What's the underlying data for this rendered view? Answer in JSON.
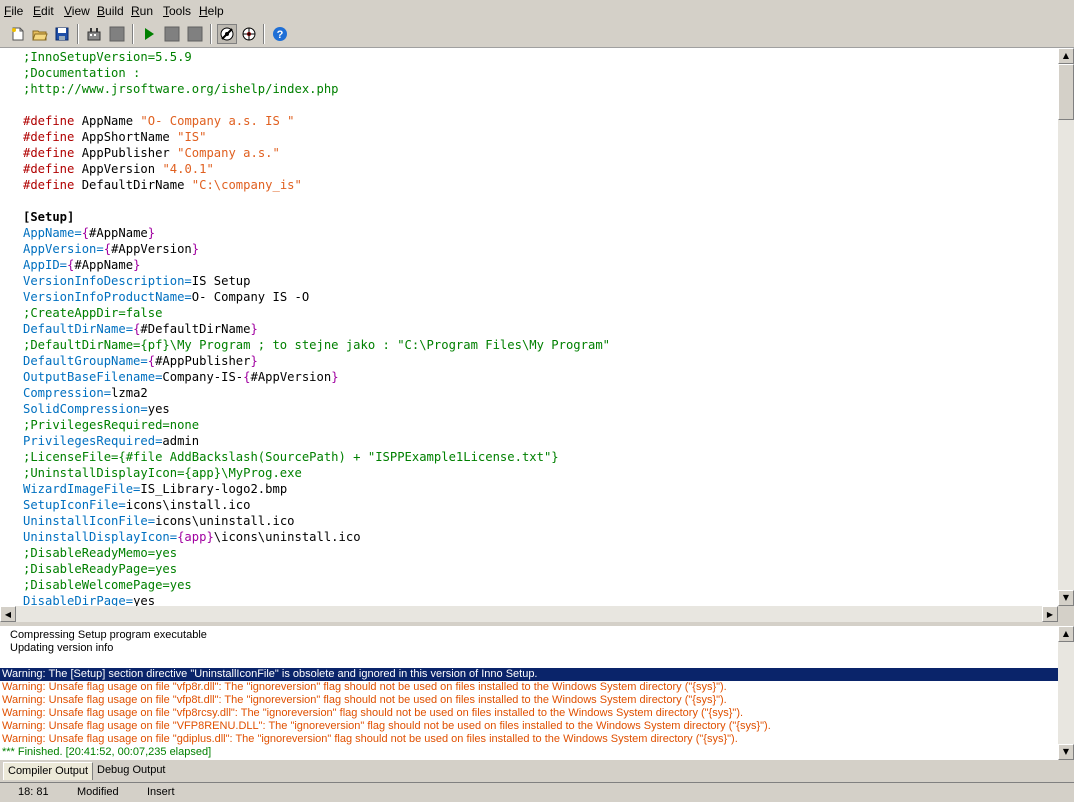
{
  "menu": [
    {
      "first": "F",
      "rest": "ile"
    },
    {
      "first": "E",
      "rest": "dit"
    },
    {
      "first": "V",
      "rest": "iew"
    },
    {
      "first": "B",
      "rest": "uild"
    },
    {
      "first": "R",
      "rest": "un"
    },
    {
      "first": "T",
      "rest": "ools"
    },
    {
      "first": "H",
      "rest": "elp"
    }
  ],
  "toolbar": {
    "icons": [
      "new-file-icon",
      "open-folder-icon",
      "save-icon",
      "compile-icon",
      "stop-compile-icon",
      "run-icon",
      "pause-icon",
      "terminate-icon",
      "compile-options-icon",
      "target-icon",
      "help-icon"
    ],
    "colors": {
      "run": "#008000",
      "help": "#1f6fd6"
    }
  },
  "editor": {
    "lines": [
      {
        "t": [
          {
            "c": "c",
            "v": ";InnoSetupVersion=5.5.9"
          }
        ]
      },
      {
        "t": [
          {
            "c": "c",
            "v": ";Documentation :"
          }
        ]
      },
      {
        "t": [
          {
            "c": "c",
            "v": ";http://www.jrsoftware.org/ishelp/index.php"
          }
        ]
      },
      {
        "t": []
      },
      {
        "t": [
          {
            "c": "dir",
            "v": "#define"
          },
          {
            "c": "tx",
            "v": " AppName "
          },
          {
            "c": "str",
            "v": "\"O- Company a.s. IS \""
          }
        ]
      },
      {
        "t": [
          {
            "c": "dir",
            "v": "#define"
          },
          {
            "c": "tx",
            "v": " AppShortName "
          },
          {
            "c": "str",
            "v": "\"IS\""
          }
        ]
      },
      {
        "t": [
          {
            "c": "dir",
            "v": "#define"
          },
          {
            "c": "tx",
            "v": " AppPublisher "
          },
          {
            "c": "str",
            "v": "\"Company a.s.\""
          }
        ]
      },
      {
        "t": [
          {
            "c": "dir",
            "v": "#define"
          },
          {
            "c": "tx",
            "v": " AppVersion "
          },
          {
            "c": "str",
            "v": "\"4.0.1\""
          }
        ]
      },
      {
        "t": [
          {
            "c": "dir",
            "v": "#define"
          },
          {
            "c": "tx",
            "v": " DefaultDirName "
          },
          {
            "c": "str",
            "v": "\"C:\\company_is\""
          }
        ]
      },
      {
        "t": []
      },
      {
        "t": [
          {
            "c": "sec",
            "v": "[Setup]"
          }
        ]
      },
      {
        "t": [
          {
            "c": "kw",
            "v": "AppName="
          },
          {
            "c": "brace",
            "v": "{"
          },
          {
            "c": "tx",
            "v": "#AppName"
          },
          {
            "c": "brace",
            "v": "}"
          }
        ]
      },
      {
        "t": [
          {
            "c": "kw",
            "v": "AppVersion="
          },
          {
            "c": "brace",
            "v": "{"
          },
          {
            "c": "tx",
            "v": "#AppVersion"
          },
          {
            "c": "brace",
            "v": "}"
          }
        ]
      },
      {
        "t": [
          {
            "c": "kw",
            "v": "AppID="
          },
          {
            "c": "brace",
            "v": "{"
          },
          {
            "c": "tx",
            "v": "#AppName"
          },
          {
            "c": "brace",
            "v": "}"
          }
        ]
      },
      {
        "t": [
          {
            "c": "kw",
            "v": "VersionInfoDescription="
          },
          {
            "c": "tx",
            "v": "IS Setup"
          }
        ]
      },
      {
        "t": [
          {
            "c": "kw",
            "v": "VersionInfoProductName="
          },
          {
            "c": "tx",
            "v": "O- Company IS -O"
          }
        ]
      },
      {
        "t": [
          {
            "c": "c",
            "v": ";CreateAppDir=false"
          }
        ]
      },
      {
        "t": [
          {
            "c": "kw",
            "v": "DefaultDirName="
          },
          {
            "c": "brace",
            "v": "{"
          },
          {
            "c": "tx",
            "v": "#DefaultDirName"
          },
          {
            "c": "brace",
            "v": "}"
          }
        ]
      },
      {
        "t": [
          {
            "c": "c",
            "v": ";DefaultDirName={pf}\\My Program ; to stejne jako : \"C:\\Program Files\\My Program\""
          }
        ]
      },
      {
        "t": [
          {
            "c": "kw",
            "v": "DefaultGroupName="
          },
          {
            "c": "brace",
            "v": "{"
          },
          {
            "c": "tx",
            "v": "#AppPublisher"
          },
          {
            "c": "brace",
            "v": "}"
          }
        ]
      },
      {
        "t": [
          {
            "c": "kw",
            "v": "OutputBaseFilename="
          },
          {
            "c": "tx",
            "v": "Company-IS-"
          },
          {
            "c": "brace",
            "v": "{"
          },
          {
            "c": "tx",
            "v": "#AppVersion"
          },
          {
            "c": "brace",
            "v": "}"
          }
        ]
      },
      {
        "t": [
          {
            "c": "kw",
            "v": "Compression="
          },
          {
            "c": "tx",
            "v": "lzma2"
          }
        ]
      },
      {
        "t": [
          {
            "c": "kw",
            "v": "SolidCompression="
          },
          {
            "c": "tx",
            "v": "yes"
          }
        ]
      },
      {
        "t": [
          {
            "c": "c",
            "v": ";PrivilegesRequired=none"
          }
        ]
      },
      {
        "t": [
          {
            "c": "kw",
            "v": "PrivilegesRequired="
          },
          {
            "c": "tx",
            "v": "admin"
          }
        ]
      },
      {
        "t": [
          {
            "c": "c",
            "v": ";LicenseFile={#file AddBackslash(SourcePath) + \"ISPPExample1License.txt\"}"
          }
        ]
      },
      {
        "t": [
          {
            "c": "c",
            "v": ";UninstallDisplayIcon={app}\\MyProg.exe"
          }
        ]
      },
      {
        "t": [
          {
            "c": "kw",
            "v": "WizardImageFile="
          },
          {
            "c": "tx",
            "v": "IS_Library-logo2.bmp"
          }
        ]
      },
      {
        "t": [
          {
            "c": "kw",
            "v": "SetupIconFile="
          },
          {
            "c": "tx",
            "v": "icons\\install.ico"
          }
        ]
      },
      {
        "t": [
          {
            "c": "kw",
            "v": "UninstallIconFile="
          },
          {
            "c": "tx",
            "v": "icons\\uninstall.ico"
          }
        ]
      },
      {
        "t": [
          {
            "c": "kw",
            "v": "UninstallDisplayIcon="
          },
          {
            "c": "brace",
            "v": "{app}"
          },
          {
            "c": "tx",
            "v": "\\icons\\uninstall.ico"
          }
        ]
      },
      {
        "t": [
          {
            "c": "c",
            "v": ";DisableReadyMemo=yes"
          }
        ]
      },
      {
        "t": [
          {
            "c": "c",
            "v": ";DisableReadyPage=yes"
          }
        ]
      },
      {
        "t": [
          {
            "c": "c",
            "v": ";DisableWelcomePage=yes"
          }
        ]
      },
      {
        "t": [
          {
            "c": "kw",
            "v": "DisableDirPage="
          },
          {
            "c": "tx",
            "v": "yes"
          }
        ]
      }
    ]
  },
  "output": {
    "lines": [
      {
        "kind": "normal",
        "text": "Compressing Setup program executable"
      },
      {
        "kind": "normal",
        "text": "Updating version info"
      },
      {
        "kind": "blank",
        "text": ""
      },
      {
        "kind": "sel",
        "text": "Warning: The [Setup] section directive \"UninstallIconFile\" is obsolete and ignored in this version of Inno Setup."
      },
      {
        "kind": "warn",
        "text": "Warning: Unsafe flag usage on file \"vfp8r.dll\": The \"ignoreversion\" flag should not be used on files installed to the Windows System directory (\"{sys}\")."
      },
      {
        "kind": "warn",
        "text": "Warning: Unsafe flag usage on file \"vfp8t.dll\": The \"ignoreversion\" flag should not be used on files installed to the Windows System directory (\"{sys}\")."
      },
      {
        "kind": "warn",
        "text": "Warning: Unsafe flag usage on file \"vfp8rcsy.dll\": The \"ignoreversion\" flag should not be used on files installed to the Windows System directory (\"{sys}\")."
      },
      {
        "kind": "warn",
        "text": "Warning: Unsafe flag usage on file \"VFP8RENU.DLL\": The \"ignoreversion\" flag should not be used on files installed to the Windows System directory (\"{sys}\")."
      },
      {
        "kind": "warn",
        "text": "Warning: Unsafe flag usage on file \"gdiplus.dll\": The \"ignoreversion\" flag should not be used on files installed to the Windows System directory (\"{sys}\")."
      },
      {
        "kind": "fin",
        "text": "*** Finished.  [20:41:52, 00:07,235 elapsed]"
      }
    ]
  },
  "tabs": {
    "compiler_output": "Compiler Output",
    "debug_output": "Debug Output"
  },
  "status": {
    "position": "18:  81",
    "modified": "Modified",
    "mode": "Insert"
  }
}
